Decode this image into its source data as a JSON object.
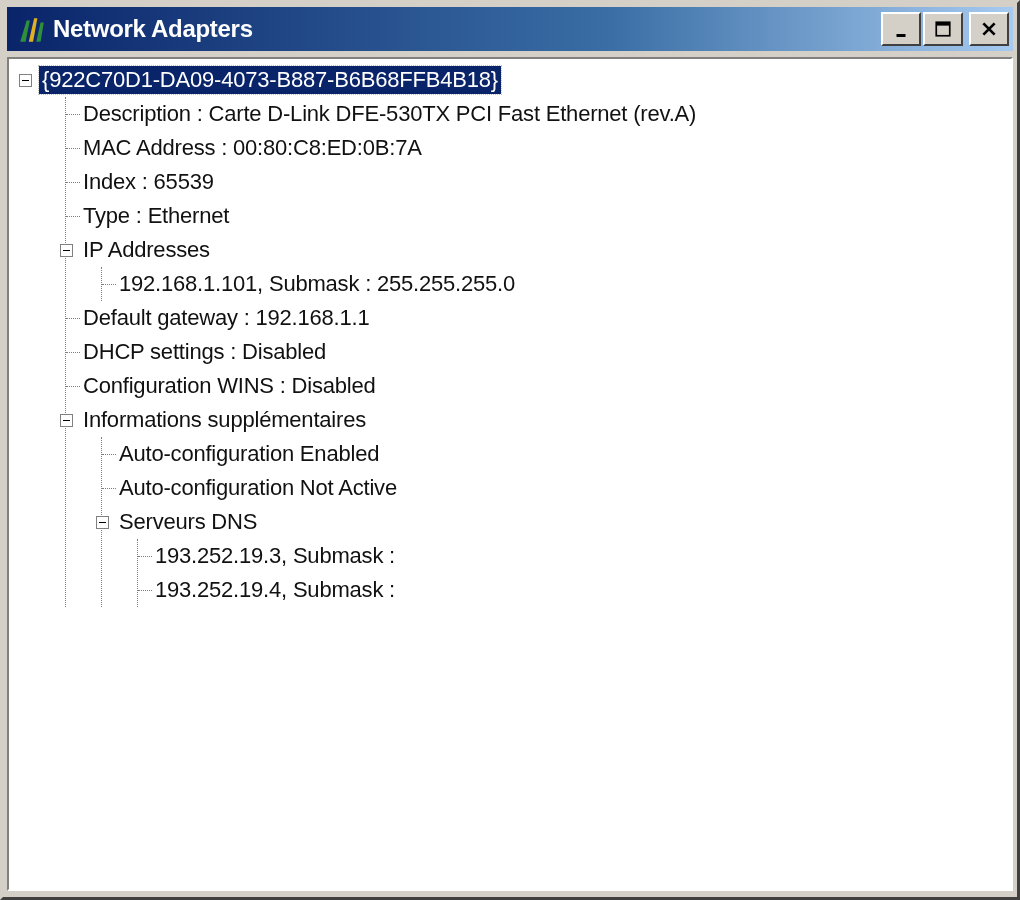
{
  "window": {
    "title": "Network Adapters"
  },
  "tree": [
    {
      "label": "{922C70D1-DA09-4073-B887-B6B68FFB4B18}",
      "selected": true,
      "expanded": true,
      "children": [
        {
          "label": "Description : Carte D-Link DFE-530TX PCI Fast Ethernet (rev.A)",
          "selected": false
        },
        {
          "label": "MAC Address : 00:80:C8:ED:0B:7A",
          "selected": false
        },
        {
          "label": "Index : 65539",
          "selected": false
        },
        {
          "label": "Type : Ethernet",
          "selected": false
        },
        {
          "label": "IP Addresses",
          "selected": false,
          "expanded": true,
          "children": [
            {
              "label": "192.168.1.101, Submask : 255.255.255.0",
              "selected": false
            }
          ]
        },
        {
          "label": "Default gateway : 192.168.1.1",
          "selected": false
        },
        {
          "label": "DHCP settings : Disabled",
          "selected": false
        },
        {
          "label": "Configuration WINS : Disabled",
          "selected": false
        },
        {
          "label": "Informations supplémentaires",
          "selected": false,
          "expanded": true,
          "children": [
            {
              "label": "Auto-configuration Enabled",
              "selected": false
            },
            {
              "label": "Auto-configuration Not Active",
              "selected": false
            },
            {
              "label": "Serveurs DNS",
              "selected": false,
              "expanded": true,
              "children": [
                {
                  "label": "193.252.19.3, Submask :",
                  "selected": false
                },
                {
                  "label": "193.252.19.4, Submask :",
                  "selected": false
                }
              ]
            }
          ]
        }
      ]
    }
  ]
}
